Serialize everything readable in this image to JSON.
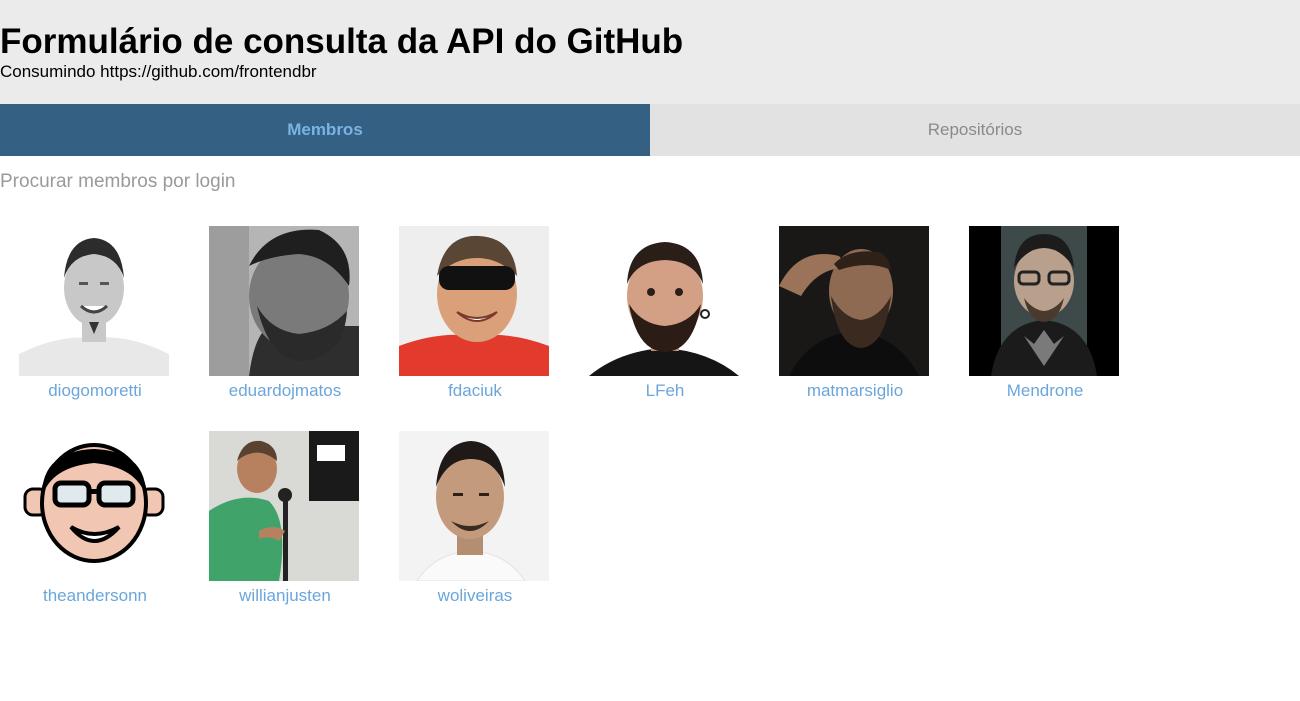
{
  "header": {
    "title": "Formulário de consulta da API do GitHub",
    "subtitle": "Consumindo https://github.com/frontendbr"
  },
  "tabs": [
    {
      "label": "Membros",
      "active": true
    },
    {
      "label": "Repositórios",
      "active": false
    }
  ],
  "search": {
    "placeholder": "Procurar membros por login",
    "value": ""
  },
  "members": [
    {
      "login": "diogomoretti"
    },
    {
      "login": "eduardojmatos"
    },
    {
      "login": "fdaciuk"
    },
    {
      "login": "LFeh"
    },
    {
      "login": "matmarsiglio"
    },
    {
      "login": "Mendrone"
    },
    {
      "login": "theandersonn"
    },
    {
      "login": "willianjusten"
    },
    {
      "login": "woliveiras"
    }
  ],
  "colors": {
    "header_bg": "#ebebeb",
    "tab_active_bg": "#336083",
    "tab_active_text": "#7ab3e4",
    "tab_inactive_bg": "#e2e2e2",
    "tab_inactive_text": "#8a8a8a",
    "link": "#6aa6db"
  }
}
